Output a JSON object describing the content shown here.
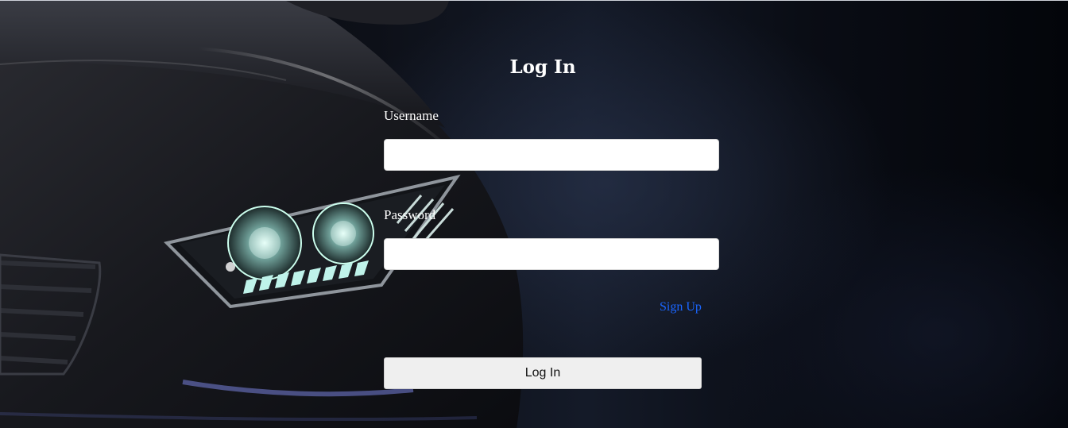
{
  "form": {
    "title": "Log In",
    "username_label": "Username",
    "username_value": "",
    "password_label": "Password",
    "password_value": "",
    "signup_link": "Sign Up",
    "login_button": "Log In"
  },
  "colors": {
    "link": "#1a66ff",
    "button_bg": "#efefef",
    "input_bg": "#ffffff",
    "text": "#ffffff"
  }
}
